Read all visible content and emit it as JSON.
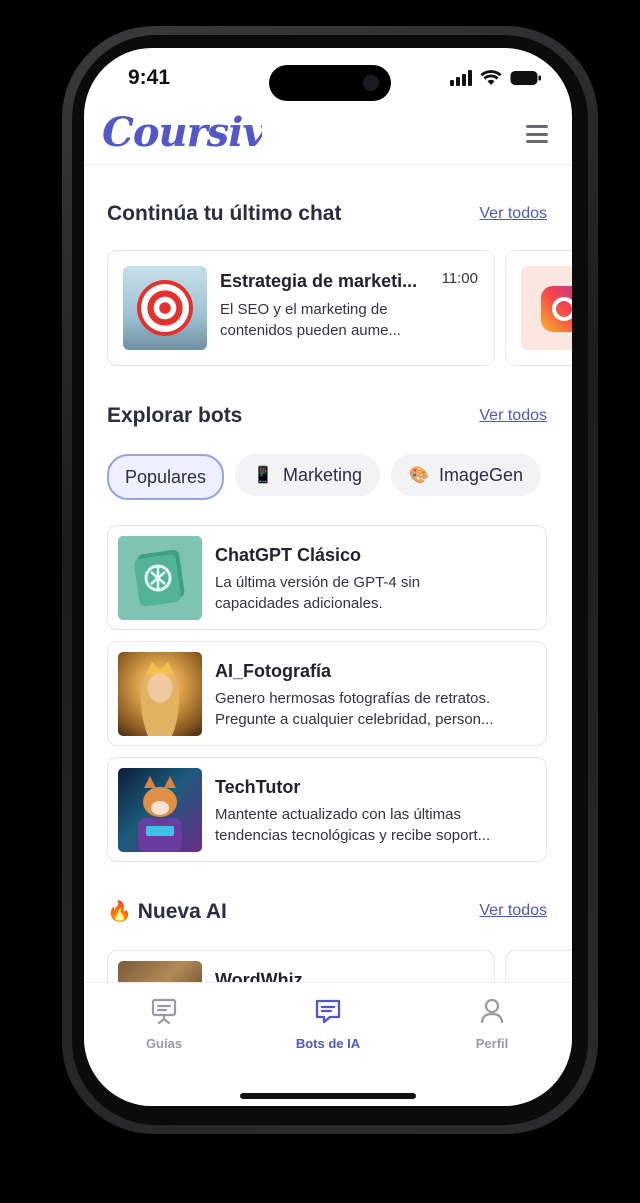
{
  "status": {
    "time": "9:41"
  },
  "header": {
    "logo": "Coursiv"
  },
  "continue_chat": {
    "title": "Continúa tu último chat",
    "see_all": "Ver todos",
    "card": {
      "name": "Estrategia de marketi...",
      "time": "11:00",
      "preview_line1": "El SEO y el marketing de",
      "preview_line2": "contenidos pueden aume..."
    }
  },
  "explore": {
    "title": "Explorar bots",
    "see_all": "Ver todos",
    "chips": [
      {
        "label": "Populares",
        "icon": "",
        "active": true
      },
      {
        "label": "Marketing",
        "icon": "mobile-phone-icon",
        "active": false
      },
      {
        "label": "ImageGen",
        "icon": "palette-icon",
        "active": false
      }
    ],
    "bots": [
      {
        "name": "ChatGPT Clásico",
        "desc1": "La última versión de GPT-4 sin",
        "desc2": "capacidades adicionales."
      },
      {
        "name": "AI_Fotografía",
        "desc1": "Genero hermosas fotografías de retratos.",
        "desc2": "Pregunte a cualquier celebridad, person..."
      },
      {
        "name": "TechTutor",
        "desc1": "Mantente actualizado con las últimas",
        "desc2": "tendencias tecnológicas y recibe soport..."
      }
    ]
  },
  "new_ai": {
    "title": "Nueva AI",
    "icon": "fire-icon",
    "see_all": "Ver todos",
    "card": {
      "name": "WordWhiz"
    }
  },
  "tabs": [
    {
      "label": "Guías",
      "icon": "presentation-board-icon",
      "active": false
    },
    {
      "label": "Bots de IA",
      "icon": "chat-message-icon",
      "active": true
    },
    {
      "label": "Perfil",
      "icon": "user-icon",
      "active": false
    }
  ],
  "colors": {
    "accent": "#4f56c7",
    "text": "#2b2d42",
    "chip_active_bg": "#eef0ff"
  }
}
